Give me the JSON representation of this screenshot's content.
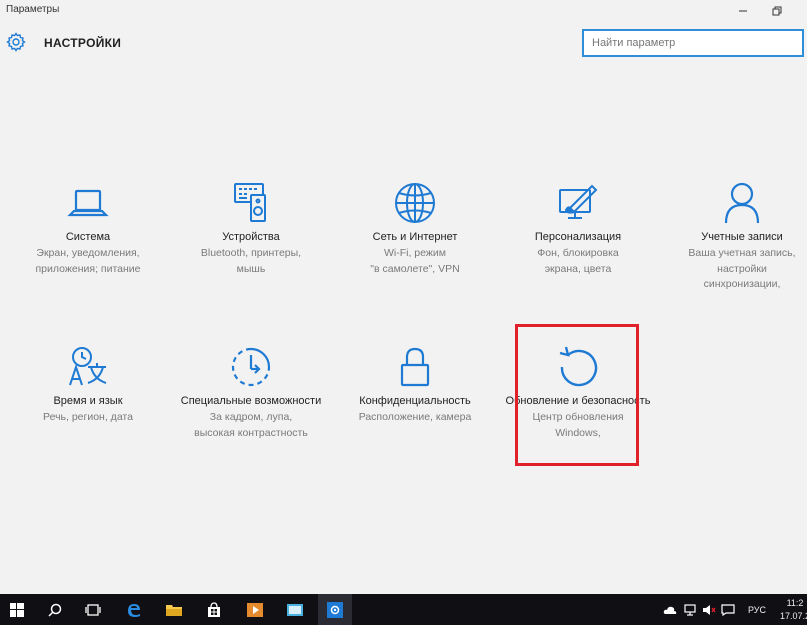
{
  "window": {
    "title": "Параметры",
    "minimize_icon": "minimize-icon",
    "restore_icon": "restore-icon"
  },
  "header": {
    "title": "НАСТРОЙКИ",
    "icon": "gear-icon"
  },
  "search": {
    "placeholder": "Найти параметр",
    "value": ""
  },
  "tiles": [
    {
      "id": "system",
      "icon": "laptop-icon",
      "label": "Система",
      "desc": [
        "Экран, уведомления,",
        "приложения; питание"
      ]
    },
    {
      "id": "devices",
      "icon": "devices-icon",
      "label": "Устройства",
      "desc": [
        "Bluetooth, принтеры,",
        "мышь"
      ]
    },
    {
      "id": "network",
      "icon": "globe-icon",
      "label": "Сеть и Интернет",
      "desc": [
        "Wi-Fi, режим",
        "\"в самолете\", VPN"
      ]
    },
    {
      "id": "personalization",
      "icon": "personalization-icon",
      "label": "Персонализация",
      "desc": [
        "Фон, блокировка",
        "экрана, цвета"
      ]
    },
    {
      "id": "accounts",
      "icon": "person-icon",
      "label": "Учетные записи",
      "desc": [
        "Ваша учетная запись,",
        "настройки",
        "синхронизации,"
      ]
    },
    {
      "id": "time-language",
      "icon": "time-language-icon",
      "label": "Время и язык",
      "desc": [
        "Речь, регион, дата"
      ]
    },
    {
      "id": "ease-of-access",
      "icon": "ease-of-access-icon",
      "label": "Специальные возможности",
      "desc": [
        "За кадром, лупа,",
        "высокая контрастность"
      ]
    },
    {
      "id": "privacy",
      "icon": "lock-icon",
      "label": "Конфиденциальность",
      "desc": [
        "Расположение, камера"
      ]
    },
    {
      "id": "update-security",
      "icon": "update-icon",
      "label": "Обновление и безопасность",
      "desc": [
        "Центр обновления",
        "Windows,"
      ]
    }
  ],
  "taskbar": {
    "items": [
      "start-icon",
      "search-icon",
      "task-view-icon",
      "edge-icon",
      "file-explorer-icon",
      "store-icon",
      "media-icon",
      "photos-icon",
      "settings-icon"
    ],
    "active": "settings-icon",
    "tray": [
      "onedrive-icon",
      "network-icon",
      "volume-icon",
      "message-icon"
    ],
    "language": "РУС",
    "time": "11:2",
    "date": "17.07.2"
  },
  "colors": {
    "accent": "#1f7ad4",
    "highlight": "#e0202a",
    "taskbar": "#101014"
  }
}
